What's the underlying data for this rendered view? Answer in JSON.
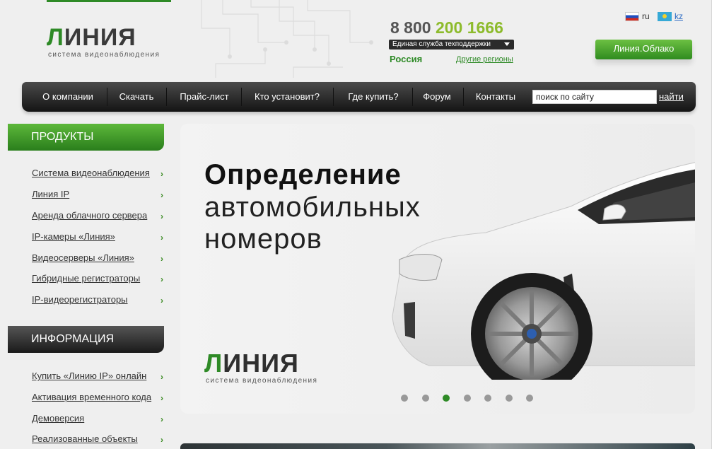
{
  "header": {
    "logo": {
      "word_first": "Л",
      "word_rest": "ИНИЯ",
      "subtitle": "система видеонаблюдения"
    },
    "phone": {
      "prefix": "8 800 ",
      "highlight": "200 1666"
    },
    "support_label": "Единая служба техподдержки",
    "region_current": "Россия",
    "region_other": "Другие регионы",
    "languages": [
      {
        "code": "ru",
        "icon": "russia-flag-icon"
      },
      {
        "code": "kz",
        "icon": "kazakhstan-flag-icon"
      }
    ],
    "cloud_button": "Линия.Облако"
  },
  "nav": {
    "items": [
      "О компании",
      "Скачать",
      "Прайс-лист",
      "Кто установит?",
      "Где купить?",
      "Форум",
      "Контакты"
    ],
    "search_value": "поиск по сайту",
    "search_button": "найти"
  },
  "sidebar": {
    "products_title": "ПРОДУКТЫ",
    "products": [
      "Система видеонаблюдения",
      "Линия IP",
      "Аренда облачного сервера",
      "IP-камеры «Линия»",
      "Видеосерверы «Линия»",
      "Гибридные регистраторы",
      "IP-видеорегистраторы"
    ],
    "info_title": "ИНФОРМАЦИЯ",
    "info": [
      "Купить «Линию IP» онлайн",
      "Активация временного кода",
      "Демоверсия",
      "Реализованные объекты"
    ]
  },
  "banner": {
    "line1": "Определение",
    "line2": "автомобильных",
    "line3": "номеров",
    "logo_word_first": "Л",
    "logo_word_rest": "ИНИЯ",
    "logo_subtitle": "система видеонаблюдения",
    "slide_count": 7,
    "active_slide": 3
  },
  "colors": {
    "brand_green": "#2e8a26",
    "phone_highlight": "#8dbb2c",
    "nav_dark": "#1a1a1a"
  }
}
